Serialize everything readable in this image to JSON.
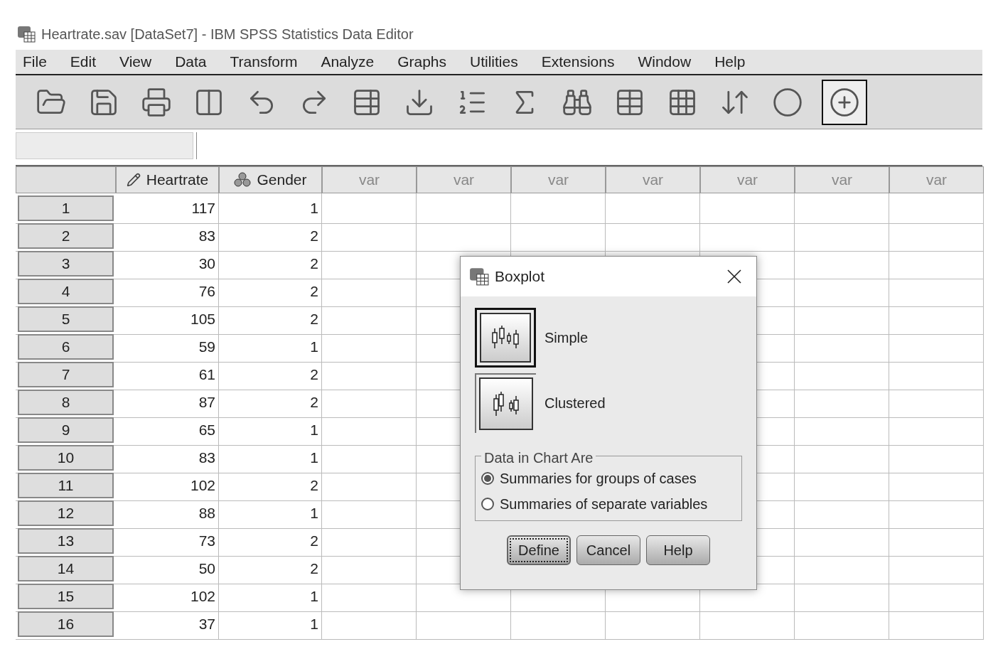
{
  "window": {
    "title": "Heartrate.sav [DataSet7] - IBM SPSS Statistics Data Editor"
  },
  "menu": [
    "File",
    "Edit",
    "View",
    "Data",
    "Transform",
    "Analyze",
    "Graphs",
    "Utilities",
    "Extensions",
    "Window",
    "Help"
  ],
  "grid": {
    "columns": [
      {
        "label": "Heartrate",
        "kind": "scale"
      },
      {
        "label": "Gender",
        "kind": "nominal"
      },
      {
        "label": "var",
        "kind": "empty"
      },
      {
        "label": "var",
        "kind": "empty"
      },
      {
        "label": "var",
        "kind": "empty"
      },
      {
        "label": "var",
        "kind": "empty"
      },
      {
        "label": "var",
        "kind": "empty"
      },
      {
        "label": "var",
        "kind": "empty"
      },
      {
        "label": "var",
        "kind": "empty"
      }
    ],
    "rows": [
      {
        "number": "1",
        "values": [
          "117",
          "1"
        ]
      },
      {
        "number": "2",
        "values": [
          "83",
          "2"
        ]
      },
      {
        "number": "3",
        "values": [
          "30",
          "2"
        ]
      },
      {
        "number": "4",
        "values": [
          "76",
          "2"
        ]
      },
      {
        "number": "5",
        "values": [
          "105",
          "2"
        ]
      },
      {
        "number": "6",
        "values": [
          "59",
          "1"
        ]
      },
      {
        "number": "7",
        "values": [
          "61",
          "2"
        ]
      },
      {
        "number": "8",
        "values": [
          "87",
          "2"
        ]
      },
      {
        "number": "9",
        "values": [
          "65",
          "1"
        ]
      },
      {
        "number": "10",
        "values": [
          "83",
          "1"
        ]
      },
      {
        "number": "11",
        "values": [
          "102",
          "2"
        ]
      },
      {
        "number": "12",
        "values": [
          "88",
          "1"
        ]
      },
      {
        "number": "13",
        "values": [
          "73",
          "2"
        ]
      },
      {
        "number": "14",
        "values": [
          "50",
          "2"
        ]
      },
      {
        "number": "15",
        "values": [
          "102",
          "1"
        ]
      },
      {
        "number": "16",
        "values": [
          "37",
          "1"
        ]
      }
    ]
  },
  "dialog": {
    "title": "Boxplot",
    "chart_types": [
      {
        "label": "Simple",
        "kind": "simple",
        "selected": true
      },
      {
        "label": "Clustered",
        "kind": "clustered",
        "selected": false
      }
    ],
    "group": {
      "label": "Data in Chart Are",
      "options": [
        {
          "label": "Summaries for groups of cases",
          "selected": true
        },
        {
          "label": "Summaries of separate variables",
          "selected": false
        }
      ]
    },
    "buttons": [
      {
        "label": "Define",
        "focused": true
      },
      {
        "label": "Cancel",
        "focused": false
      },
      {
        "label": "Help",
        "focused": false
      }
    ]
  }
}
